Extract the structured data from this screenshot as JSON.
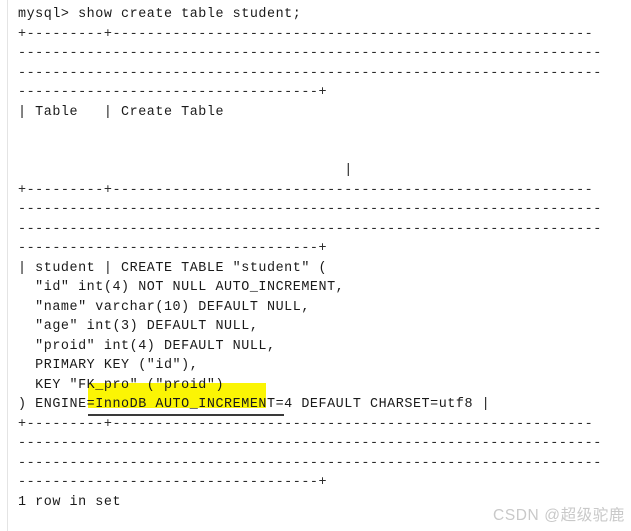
{
  "terminal": {
    "app": "mysql-client",
    "background_color": "#ffffff",
    "text_color": "#1a1a1a",
    "prompt": "mysql>",
    "command": "show create table student;",
    "prompt_line": "mysql> show create table student;",
    "lines": [
      {
        "id": "command",
        "text": "mysql> show create table student;",
        "kind": "command"
      },
      {
        "id": "rule-top-1",
        "text": "+---------+--------------------------------------------------------",
        "kind": "rule"
      },
      {
        "id": "rule-top-2",
        "text": "--------------------------------------------------------------------",
        "kind": "rule"
      },
      {
        "id": "rule-top-3",
        "text": "--------------------------------------------------------------------",
        "kind": "rule"
      },
      {
        "id": "rule-top-4",
        "text": "-----------------------------------+",
        "kind": "rule"
      },
      {
        "id": "header-row",
        "text": "| Table   | Create Table",
        "kind": "text"
      },
      {
        "id": "header-pad-1",
        "text": "",
        "kind": "blank"
      },
      {
        "id": "header-pad-2",
        "text": "",
        "kind": "blank"
      },
      {
        "id": "header-pipe",
        "text": "                                      |",
        "kind": "text"
      },
      {
        "id": "rule-mid-1",
        "text": "+---------+--------------------------------------------------------",
        "kind": "rule"
      },
      {
        "id": "rule-mid-2",
        "text": "--------------------------------------------------------------------",
        "kind": "rule"
      },
      {
        "id": "rule-mid-3",
        "text": "--------------------------------------------------------------------",
        "kind": "rule"
      },
      {
        "id": "rule-mid-4",
        "text": "-----------------------------------+",
        "kind": "rule"
      },
      {
        "id": "ddl-1",
        "text": "| student | CREATE TABLE \"student\" (",
        "kind": "text"
      },
      {
        "id": "ddl-2",
        "text": "  \"id\" int(4) NOT NULL AUTO_INCREMENT,",
        "kind": "text"
      },
      {
        "id": "ddl-3",
        "text": "  \"name\" varchar(10) DEFAULT NULL,",
        "kind": "text"
      },
      {
        "id": "ddl-4",
        "text": "  \"age\" int(3) DEFAULT NULL,",
        "kind": "text"
      },
      {
        "id": "ddl-5",
        "text": "  \"proid\" int(4) DEFAULT NULL,",
        "kind": "text"
      },
      {
        "id": "ddl-6",
        "text": "  PRIMARY KEY (\"id\"),",
        "kind": "text"
      },
      {
        "id": "ddl-7",
        "text": "  KEY \"FK_pro\" (\"proid\")",
        "kind": "text"
      },
      {
        "id": "ddl-8",
        "text": ") ENGINE=InnoDB AUTO_INCREMENT=4 DEFAULT CHARSET=utf8 |",
        "kind": "text"
      },
      {
        "id": "rule-bot-1",
        "text": "+---------+--------------------------------------------------------",
        "kind": "rule"
      },
      {
        "id": "rule-bot-2",
        "text": "--------------------------------------------------------------------",
        "kind": "rule"
      },
      {
        "id": "rule-bot-3",
        "text": "--------------------------------------------------------------------",
        "kind": "rule"
      },
      {
        "id": "rule-bot-4",
        "text": "-----------------------------------+",
        "kind": "rule"
      },
      {
        "id": "result",
        "text": "1 row in set",
        "kind": "text"
      }
    ],
    "result_status": "1 row in set",
    "result_row_count": 1
  },
  "table_definition": {
    "table_name": "student",
    "columns": [
      {
        "name": "id",
        "type": "int(4)",
        "nullable": "NOT NULL",
        "extra": "AUTO_INCREMENT"
      },
      {
        "name": "name",
        "type": "varchar(10)",
        "nullable": "DEFAULT NULL",
        "extra": ""
      },
      {
        "name": "age",
        "type": "int(3)",
        "nullable": "DEFAULT NULL",
        "extra": ""
      },
      {
        "name": "proid",
        "type": "int(4)",
        "nullable": "DEFAULT NULL",
        "extra": ""
      }
    ],
    "primary_key": "id",
    "key_name": "FK_pro",
    "key_column": "proid",
    "engine": "InnoDB",
    "auto_increment": "4",
    "default_charset": "utf8",
    "result_columns": [
      "Table",
      "Create Table"
    ]
  },
  "annotations": {
    "highlight": {
      "label": "KEY \"FK_pro\" (\"proid\")",
      "color": "#fbf504",
      "type": "marker-highlight"
    },
    "strikethrough": {
      "label": "ENGINE=InnoDB AUTO_INCREMENT",
      "color": "#3a3a3a",
      "type": "strikethrough"
    }
  },
  "watermark": {
    "text": "CSDN @超级驼鹿",
    "color": "#c9c9c9"
  }
}
